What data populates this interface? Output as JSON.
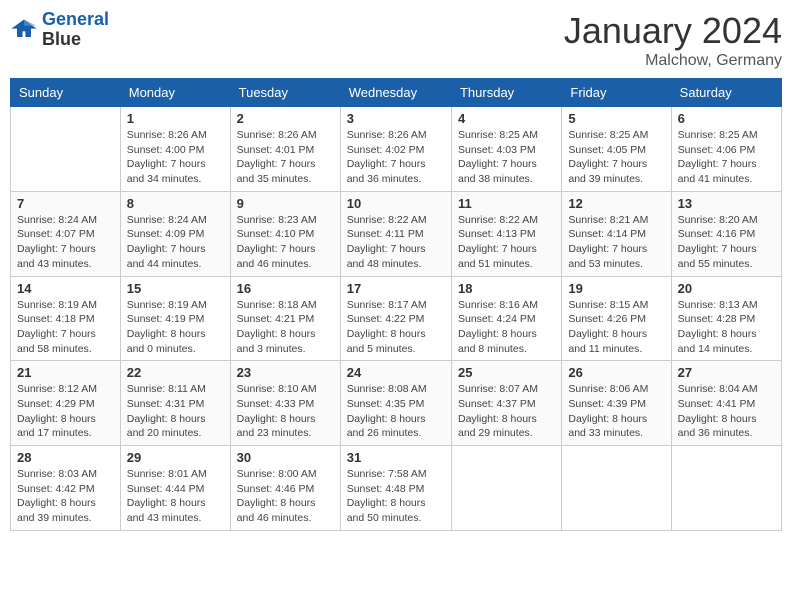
{
  "header": {
    "logo_line1": "General",
    "logo_line2": "Blue",
    "month": "January 2024",
    "location": "Malchow, Germany"
  },
  "weekdays": [
    "Sunday",
    "Monday",
    "Tuesday",
    "Wednesday",
    "Thursday",
    "Friday",
    "Saturday"
  ],
  "weeks": [
    [
      {
        "day": "",
        "info": ""
      },
      {
        "day": "1",
        "info": "Sunrise: 8:26 AM\nSunset: 4:00 PM\nDaylight: 7 hours\nand 34 minutes."
      },
      {
        "day": "2",
        "info": "Sunrise: 8:26 AM\nSunset: 4:01 PM\nDaylight: 7 hours\nand 35 minutes."
      },
      {
        "day": "3",
        "info": "Sunrise: 8:26 AM\nSunset: 4:02 PM\nDaylight: 7 hours\nand 36 minutes."
      },
      {
        "day": "4",
        "info": "Sunrise: 8:25 AM\nSunset: 4:03 PM\nDaylight: 7 hours\nand 38 minutes."
      },
      {
        "day": "5",
        "info": "Sunrise: 8:25 AM\nSunset: 4:05 PM\nDaylight: 7 hours\nand 39 minutes."
      },
      {
        "day": "6",
        "info": "Sunrise: 8:25 AM\nSunset: 4:06 PM\nDaylight: 7 hours\nand 41 minutes."
      }
    ],
    [
      {
        "day": "7",
        "info": "Sunrise: 8:24 AM\nSunset: 4:07 PM\nDaylight: 7 hours\nand 43 minutes."
      },
      {
        "day": "8",
        "info": "Sunrise: 8:24 AM\nSunset: 4:09 PM\nDaylight: 7 hours\nand 44 minutes."
      },
      {
        "day": "9",
        "info": "Sunrise: 8:23 AM\nSunset: 4:10 PM\nDaylight: 7 hours\nand 46 minutes."
      },
      {
        "day": "10",
        "info": "Sunrise: 8:22 AM\nSunset: 4:11 PM\nDaylight: 7 hours\nand 48 minutes."
      },
      {
        "day": "11",
        "info": "Sunrise: 8:22 AM\nSunset: 4:13 PM\nDaylight: 7 hours\nand 51 minutes."
      },
      {
        "day": "12",
        "info": "Sunrise: 8:21 AM\nSunset: 4:14 PM\nDaylight: 7 hours\nand 53 minutes."
      },
      {
        "day": "13",
        "info": "Sunrise: 8:20 AM\nSunset: 4:16 PM\nDaylight: 7 hours\nand 55 minutes."
      }
    ],
    [
      {
        "day": "14",
        "info": "Sunrise: 8:19 AM\nSunset: 4:18 PM\nDaylight: 7 hours\nand 58 minutes."
      },
      {
        "day": "15",
        "info": "Sunrise: 8:19 AM\nSunset: 4:19 PM\nDaylight: 8 hours\nand 0 minutes."
      },
      {
        "day": "16",
        "info": "Sunrise: 8:18 AM\nSunset: 4:21 PM\nDaylight: 8 hours\nand 3 minutes."
      },
      {
        "day": "17",
        "info": "Sunrise: 8:17 AM\nSunset: 4:22 PM\nDaylight: 8 hours\nand 5 minutes."
      },
      {
        "day": "18",
        "info": "Sunrise: 8:16 AM\nSunset: 4:24 PM\nDaylight: 8 hours\nand 8 minutes."
      },
      {
        "day": "19",
        "info": "Sunrise: 8:15 AM\nSunset: 4:26 PM\nDaylight: 8 hours\nand 11 minutes."
      },
      {
        "day": "20",
        "info": "Sunrise: 8:13 AM\nSunset: 4:28 PM\nDaylight: 8 hours\nand 14 minutes."
      }
    ],
    [
      {
        "day": "21",
        "info": "Sunrise: 8:12 AM\nSunset: 4:29 PM\nDaylight: 8 hours\nand 17 minutes."
      },
      {
        "day": "22",
        "info": "Sunrise: 8:11 AM\nSunset: 4:31 PM\nDaylight: 8 hours\nand 20 minutes."
      },
      {
        "day": "23",
        "info": "Sunrise: 8:10 AM\nSunset: 4:33 PM\nDaylight: 8 hours\nand 23 minutes."
      },
      {
        "day": "24",
        "info": "Sunrise: 8:08 AM\nSunset: 4:35 PM\nDaylight: 8 hours\nand 26 minutes."
      },
      {
        "day": "25",
        "info": "Sunrise: 8:07 AM\nSunset: 4:37 PM\nDaylight: 8 hours\nand 29 minutes."
      },
      {
        "day": "26",
        "info": "Sunrise: 8:06 AM\nSunset: 4:39 PM\nDaylight: 8 hours\nand 33 minutes."
      },
      {
        "day": "27",
        "info": "Sunrise: 8:04 AM\nSunset: 4:41 PM\nDaylight: 8 hours\nand 36 minutes."
      }
    ],
    [
      {
        "day": "28",
        "info": "Sunrise: 8:03 AM\nSunset: 4:42 PM\nDaylight: 8 hours\nand 39 minutes."
      },
      {
        "day": "29",
        "info": "Sunrise: 8:01 AM\nSunset: 4:44 PM\nDaylight: 8 hours\nand 43 minutes."
      },
      {
        "day": "30",
        "info": "Sunrise: 8:00 AM\nSunset: 4:46 PM\nDaylight: 8 hours\nand 46 minutes."
      },
      {
        "day": "31",
        "info": "Sunrise: 7:58 AM\nSunset: 4:48 PM\nDaylight: 8 hours\nand 50 minutes."
      },
      {
        "day": "",
        "info": ""
      },
      {
        "day": "",
        "info": ""
      },
      {
        "day": "",
        "info": ""
      }
    ]
  ]
}
